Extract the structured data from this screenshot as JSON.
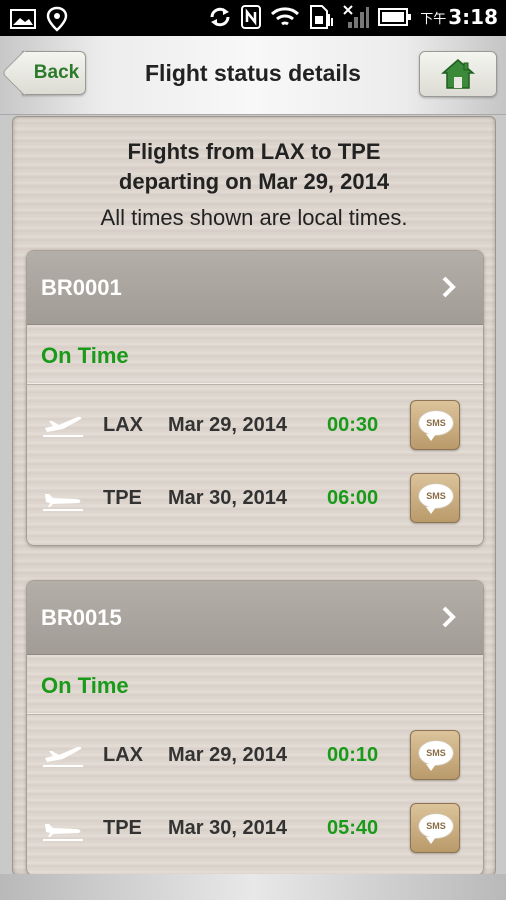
{
  "status_bar": {
    "time": "3:18",
    "ampm": "下午",
    "icons": [
      "image-icon",
      "location-icon",
      "sync-icon",
      "nfc-icon",
      "wifi-icon",
      "sim-icon",
      "signal-icon",
      "battery-icon"
    ]
  },
  "header": {
    "back_label": "Back",
    "title": "Flight status details",
    "home_icon": "home-icon"
  },
  "summary": {
    "route_line1": "Flights from LAX to TPE",
    "route_line2": "departing on Mar 29, 2014",
    "note": "All times shown are local times."
  },
  "flights": [
    {
      "number": "BR0001",
      "status": "On Time",
      "legs": [
        {
          "type": "departure",
          "airport": "LAX",
          "date": "Mar 29, 2014",
          "time": "00:30",
          "sms_label": "SMS"
        },
        {
          "type": "arrival",
          "airport": "TPE",
          "date": "Mar 30, 2014",
          "time": "06:00",
          "sms_label": "SMS"
        }
      ]
    },
    {
      "number": "BR0015",
      "status": "On Time",
      "legs": [
        {
          "type": "departure",
          "airport": "LAX",
          "date": "Mar 29, 2014",
          "time": "00:10",
          "sms_label": "SMS"
        },
        {
          "type": "arrival",
          "airport": "TPE",
          "date": "Mar 30, 2014",
          "time": "05:40",
          "sms_label": "SMS"
        }
      ]
    }
  ],
  "colors": {
    "status_green": "#1a9a1a",
    "back_green": "#2c7a2c",
    "card_header": "#a8a29c"
  }
}
